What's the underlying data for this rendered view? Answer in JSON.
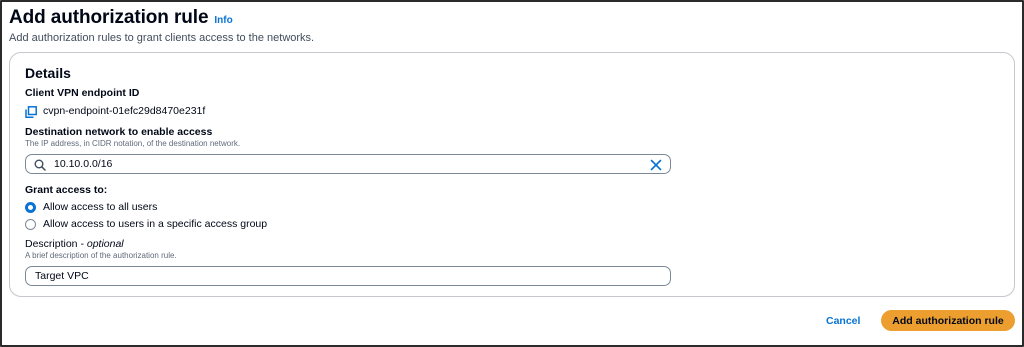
{
  "header": {
    "title": "Add authorization rule",
    "info_link": "Info",
    "subtitle": "Add authorization rules to grant clients access to the networks."
  },
  "details": {
    "heading": "Details",
    "endpoint": {
      "label": "Client VPN endpoint ID",
      "value": "cvpn-endpoint-01efc29d8470e231f",
      "icon": "copy-icon"
    },
    "destination": {
      "label": "Destination network to enable access",
      "description": "The IP address, in CIDR notation, of the destination network.",
      "value": "10.10.0.0/16",
      "icons": [
        "search-icon",
        "clear-icon"
      ]
    },
    "grant": {
      "label": "Grant access to:",
      "options": [
        {
          "label": "Allow access to all users",
          "checked": true
        },
        {
          "label": "Allow access to users in a specific access group",
          "checked": false
        }
      ]
    },
    "description": {
      "label": "Description - ",
      "label_optional": "optional",
      "hint": "A brief description of the authorization rule.",
      "value": "Target VPC"
    }
  },
  "actions": {
    "cancel": "Cancel",
    "submit": "Add authorization rule"
  },
  "colors": {
    "accent": "#0972d3",
    "primary_button": "#ec9f2f",
    "text": "#000716",
    "border": "#7d8998"
  }
}
